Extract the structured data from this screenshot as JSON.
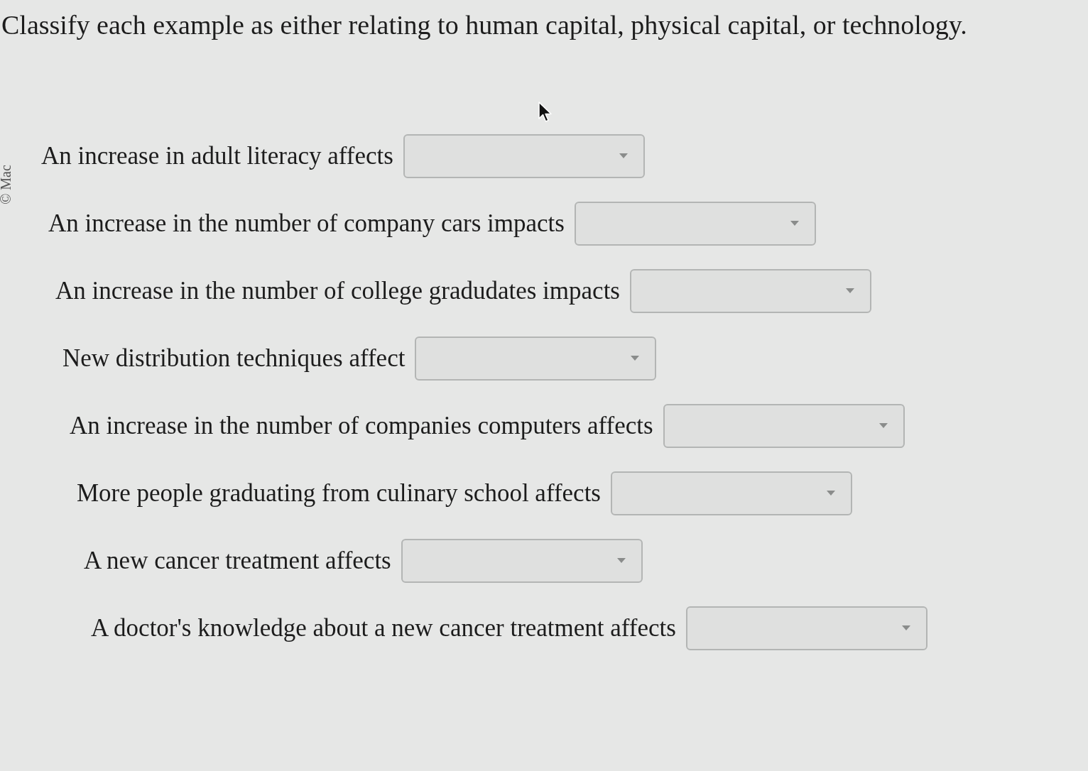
{
  "side_note": "© Mac",
  "title": "Classify each example as either relating to human capital, physical capital, or technology.",
  "items": [
    {
      "prompt": "An increase in adult literacy affects"
    },
    {
      "prompt": "An increase in the number of company cars impacts"
    },
    {
      "prompt": "An increase in the number of college gradudates impacts"
    },
    {
      "prompt": "New distribution techniques affect"
    },
    {
      "prompt": "An increase in the number of companies computers affects"
    },
    {
      "prompt": "More people graduating from culinary school affects"
    },
    {
      "prompt": "A new cancer treatment affects"
    },
    {
      "prompt": "A doctor's knowledge about a new cancer treatment affects"
    }
  ]
}
